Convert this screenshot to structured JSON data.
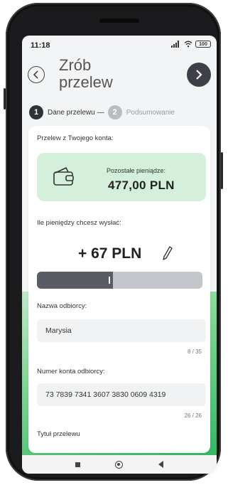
{
  "status_bar": {
    "time": "11:18",
    "battery": "100"
  },
  "header": {
    "title_line1": "Zrób",
    "title_line2": "przelew"
  },
  "steps": [
    {
      "number": "1",
      "label": "Dane przelewu",
      "separator": "—"
    },
    {
      "number": "2",
      "label": "Podsumowanie"
    }
  ],
  "form": {
    "from_account_label": "Przelew z Twojego konta:",
    "balance_caption": "Pozostałe pieniądze:",
    "balance_value": "477,00 PLN",
    "amount_label": "Ile pieniędzy chcesz wysłać:",
    "amount_value": "+ 67 PLN",
    "slider_fraction": 0.46,
    "recipient_label": "Nazwa odbiorcy:",
    "recipient_value": "Marysia",
    "recipient_counter": "8 / 35",
    "account_label": "Numer konta odbiorcy:",
    "account_value": "73 7839 7341 3607 3830 0609 4319",
    "account_counter": "26 / 26",
    "title_label": "Tytuł przelewu"
  },
  "icons": {
    "back": "chevron-left-icon",
    "next": "chevron-right-icon",
    "wallet": "wallet-icon",
    "edit": "pencil-icon"
  },
  "colors": {
    "accent_dark": "#3e3f47",
    "balance_bg": "#d4f0dc",
    "green": "#34b864"
  }
}
